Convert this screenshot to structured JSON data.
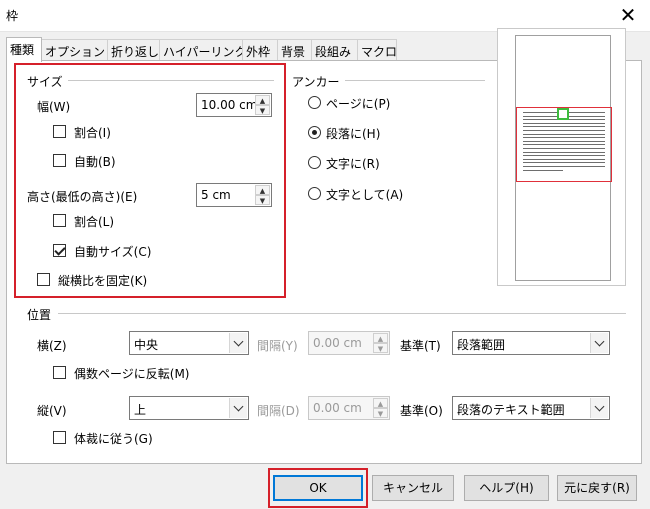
{
  "window": {
    "title": "枠",
    "close_glyph": "✕"
  },
  "tabs": [
    "種類",
    "オプション",
    "折り返し",
    "ハイパーリンク",
    "外枠",
    "背景",
    "段組み",
    "マクロ"
  ],
  "size": {
    "title": "サイズ",
    "width_label": "幅(W)",
    "width_value": "10.00 cm",
    "width_relative": "割合(I)",
    "width_auto": "自動(B)",
    "height_label": "高さ(最低の高さ)(E)",
    "height_value": "5 cm",
    "height_relative": "割合(L)",
    "height_auto": "自動サイズ(C)",
    "keep_ratio": "縦横比を固定(K)"
  },
  "anchor": {
    "title": "アンカー",
    "options": [
      "ページに(P)",
      "段落に(H)",
      "文字に(R)",
      "文字として(A)"
    ],
    "selected": "段落に(H)"
  },
  "position": {
    "title": "位置",
    "horizontal_label": "横(Z)",
    "horizontal_value": "中央",
    "h_spacing_label": "間隔(Y)",
    "h_spacing_value": "0.00 cm",
    "h_base_label": "基準(T)",
    "h_base_value": "段落範囲",
    "mirror_even": "偶数ページに反転(M)",
    "vertical_label": "縦(V)",
    "vertical_value": "上",
    "v_spacing_label": "間隔(D)",
    "v_spacing_value": "0.00 cm",
    "v_base_label": "基準(O)",
    "v_base_value": "段落のテキスト範囲",
    "follow_text_flow": "体裁に従う(G)"
  },
  "buttons": {
    "ok": "OK",
    "cancel": "キャンセル",
    "help": "ヘルプ(H)",
    "reset": "元に戻す(R)"
  },
  "state": {
    "width_relative": false,
    "width_auto": false,
    "height_relative": false,
    "height_auto": true,
    "keep_ratio": false,
    "mirror_even": false,
    "follow_text_flow": false
  },
  "colors": {
    "highlight": "#d5202a",
    "focus": "#0078d7",
    "preview_frame": "#3dbb3d"
  }
}
